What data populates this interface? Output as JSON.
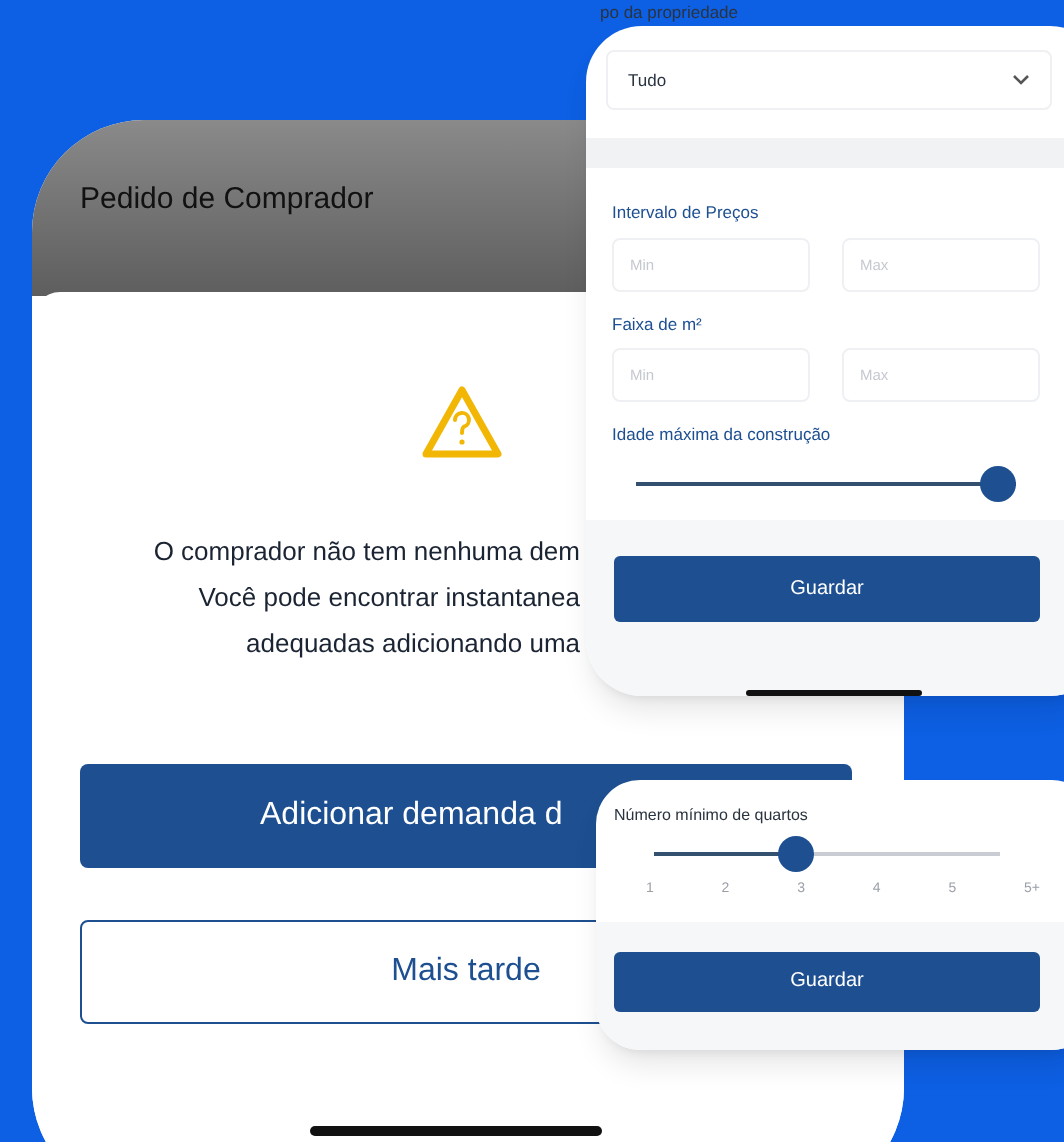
{
  "back_screen": {
    "header_title": "Pedido de Comprador",
    "message_lines": [
      "O comprador não tem nenhuma dem",
      "Você pode encontrar instantanea",
      "adequadas adicionando uma"
    ],
    "primary_button": "Adicionar demanda d",
    "secondary_button": "Mais tarde"
  },
  "filter_panel": {
    "property_type_label": "po da propriedade",
    "property_type": {
      "value": "Tudo"
    },
    "price_range": {
      "label": "Intervalo de Preços",
      "min_placeholder": "Min",
      "max_placeholder": "Max"
    },
    "area_range": {
      "label": "Faixa de m²",
      "min_placeholder": "Min",
      "max_placeholder": "Max"
    },
    "max_age": {
      "label": "Idade máxima da construção",
      "level": 1
    },
    "save_button": "Guardar"
  },
  "rooms_panel": {
    "label": "Número mínimo de quartos",
    "level": 0.4,
    "ticks": [
      "1",
      "2",
      "3",
      "4",
      "5",
      "5+"
    ],
    "save_button": "Guardar"
  }
}
